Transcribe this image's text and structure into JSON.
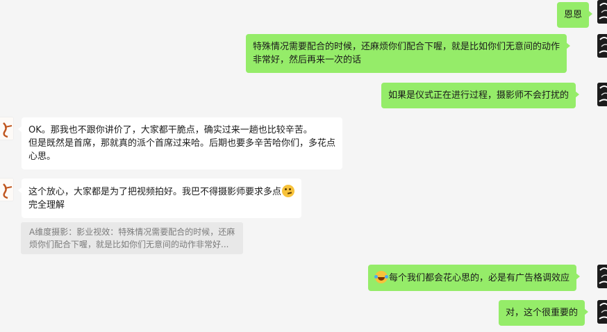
{
  "messages": [
    {
      "side": "mine",
      "lines": [
        "恩恩"
      ]
    },
    {
      "side": "mine",
      "lines": [
        "特殊情况需要配合的时候，还麻烦你们配合下喔，就是比如你们无意间的动作",
        "非常好，然后再来一次的话"
      ]
    },
    {
      "side": "mine",
      "lines": [
        "如果是仪式正在进行过程，摄影师不会打扰的"
      ]
    },
    {
      "side": "theirs",
      "lines": [
        "OK。那我也不跟你讲价了，大家都干脆点，确实过来一趟也比较辛苦。",
        "但是既然是首席，那就真的派个首席过来哈。后期也要多辛苦哈你们，多花点",
        "心思。"
      ]
    },
    {
      "side": "theirs",
      "lines": [
        "这个放心，大家都是为了把视频拍好。我巴不得摄影师要求多点",
        "完全理解"
      ],
      "emoji": "thinking-face"
    },
    {
      "side": "mine",
      "lines": [
        "每个我们都会花心思的，必是有广告格调效应"
      ],
      "emoji": "laughing-tears-face"
    },
    {
      "side": "mine",
      "lines": [
        "对，这个很重要的"
      ]
    }
  ],
  "quote": {
    "lines": [
      "A维度摄影：影业视效：特殊情况需要配合的时候，还麻",
      "烦你们配合下喔，就是比如你们无意间的动作非常好..."
    ]
  },
  "colors": {
    "background": "#f5f5f5",
    "my_bubble": "#95ec69",
    "their_bubble": "#ffffff",
    "quote_bg": "#e8e8e8"
  },
  "avatars": {
    "mine": "ink-art-avatar",
    "theirs": "calligraphy-logo-avatar"
  }
}
